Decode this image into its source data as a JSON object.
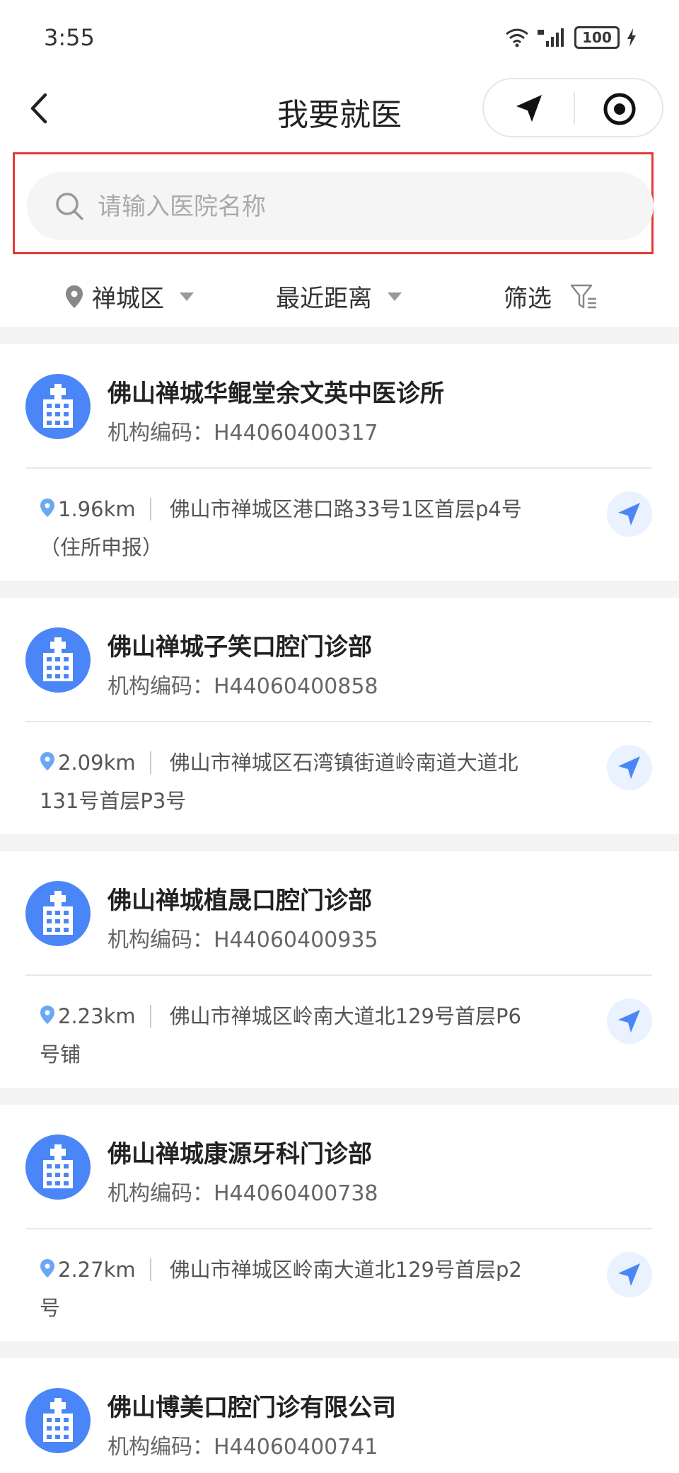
{
  "status_bar": {
    "time": "3:55",
    "battery": "100"
  },
  "header": {
    "title": "我要就医"
  },
  "search": {
    "placeholder": "请输入医院名称",
    "value": ""
  },
  "filters": {
    "district": "禅城区",
    "sort": "最近距离",
    "filter": "筛选"
  },
  "code_label": "机构编码：",
  "hospitals": [
    {
      "name": "佛山禅城华鲲堂余文英中医诊所",
      "code": "H44060400317",
      "distance": "1.96km",
      "address": "佛山市禅城区港口路33号1区首层p4号（住所申报）"
    },
    {
      "name": "佛山禅城子笑口腔门诊部",
      "code": "H44060400858",
      "distance": "2.09km",
      "address": "佛山市禅城区石湾镇街道岭南道大道北131号首层P3号"
    },
    {
      "name": "佛山禅城植晟口腔门诊部",
      "code": "H44060400935",
      "distance": "2.23km",
      "address": "佛山市禅城区岭南大道北129号首层P6号铺"
    },
    {
      "name": "佛山禅城康源牙科门诊部",
      "code": "H44060400738",
      "distance": "2.27km",
      "address": "佛山市禅城区岭南大道北129号首层p2号"
    },
    {
      "name": "佛山博美口腔门诊有限公司",
      "code": "H44060400741"
    }
  ],
  "colors": {
    "accent": "#4a86f7",
    "nav_bg": "#eaf1ff",
    "highlight": "#e53935"
  },
  "icons": [
    "back-arrow-icon",
    "location-arrow-icon",
    "record-circle-icon",
    "search-icon",
    "map-pin-icon",
    "chevron-down-icon",
    "filter-funnel-icon",
    "hospital-building-icon",
    "navigate-icon"
  ]
}
